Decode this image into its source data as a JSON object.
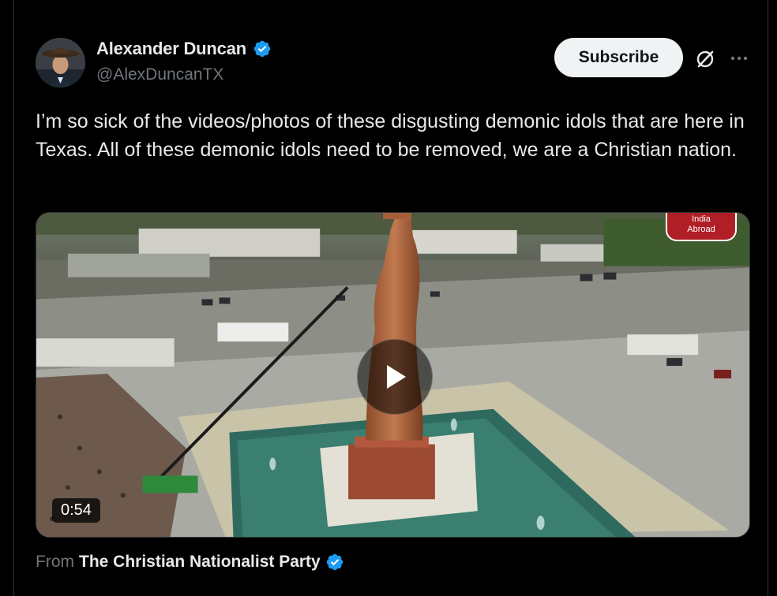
{
  "author": {
    "display_name": "Alexander Duncan",
    "handle": "@AlexDuncanTX",
    "verified": true
  },
  "actions": {
    "subscribe_label": "Subscribe"
  },
  "icons": {
    "grok": "grok-icon",
    "more": "more-icon",
    "verified": "verified-badge-icon",
    "play": "play-icon"
  },
  "tweet": {
    "text": "I’m so sick of the videos/photos of these disgusting demonic idols that are here in Texas. All of these demonic idols need to be removed, we are a Christian nation."
  },
  "media": {
    "duration": "0:54",
    "watermark_top": "India",
    "watermark_bottom": "Abroad"
  },
  "source": {
    "from_label": "From",
    "name": "The Christian Nationalist Party",
    "verified": true
  },
  "colors": {
    "background": "#000000",
    "text_primary": "#e7e9ea",
    "text_secondary": "#71767b",
    "verified_blue": "#1d9bf0",
    "button_bg": "#eff3f4"
  }
}
